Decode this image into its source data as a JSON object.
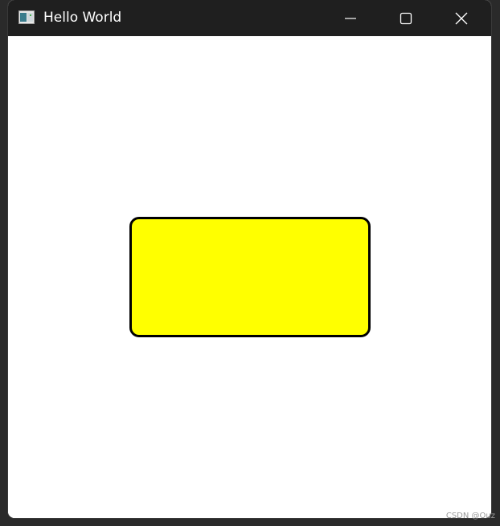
{
  "window": {
    "title": "Hello World",
    "icon": "app-window-icon"
  },
  "caption_buttons": {
    "minimize_icon": "minimize-icon",
    "maximize_icon": "maximize-icon",
    "close_icon": "close-icon"
  },
  "canvas": {
    "shape": "rounded-rectangle",
    "fill_color": "#ffff00",
    "stroke_color": "#000000"
  },
  "colors": {
    "titlebar": "#1f1f1f",
    "client_background": "#ffffff"
  },
  "watermark": {
    "text": "CSDN @Ouz"
  }
}
